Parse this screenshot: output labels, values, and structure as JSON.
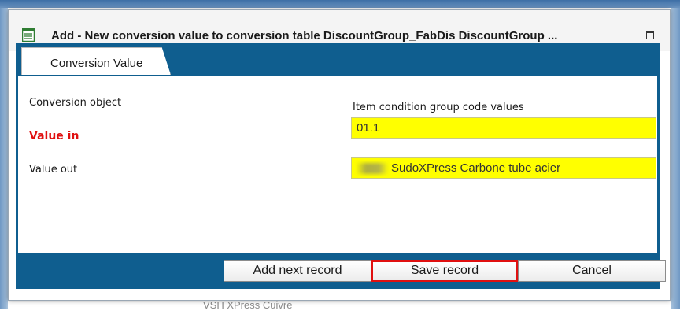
{
  "background": {
    "partial_text": "VSH XPress Cuivre"
  },
  "dialog": {
    "title": "Add - New conversion value to conversion table DiscountGroup_FabDis DiscountGroup ...",
    "icon": "form-icon",
    "maximize_icon": "maximize-icon"
  },
  "tabs": [
    {
      "label": "Conversion Value",
      "active": true
    }
  ],
  "form": {
    "conversion_object_label": "Conversion object",
    "conversion_object_value": "Item condition group code values",
    "value_in_label": "Value in",
    "value_in_value": "01.1",
    "value_out_label": "Value out",
    "value_out_value": "SudoXPress Carbone tube acier"
  },
  "buttons": {
    "add_next": "Add next record",
    "save": "Save record",
    "cancel": "Cancel"
  },
  "colors": {
    "accent": "#0f5e8f",
    "required": "#e01010",
    "field_highlight": "#ffff00"
  }
}
